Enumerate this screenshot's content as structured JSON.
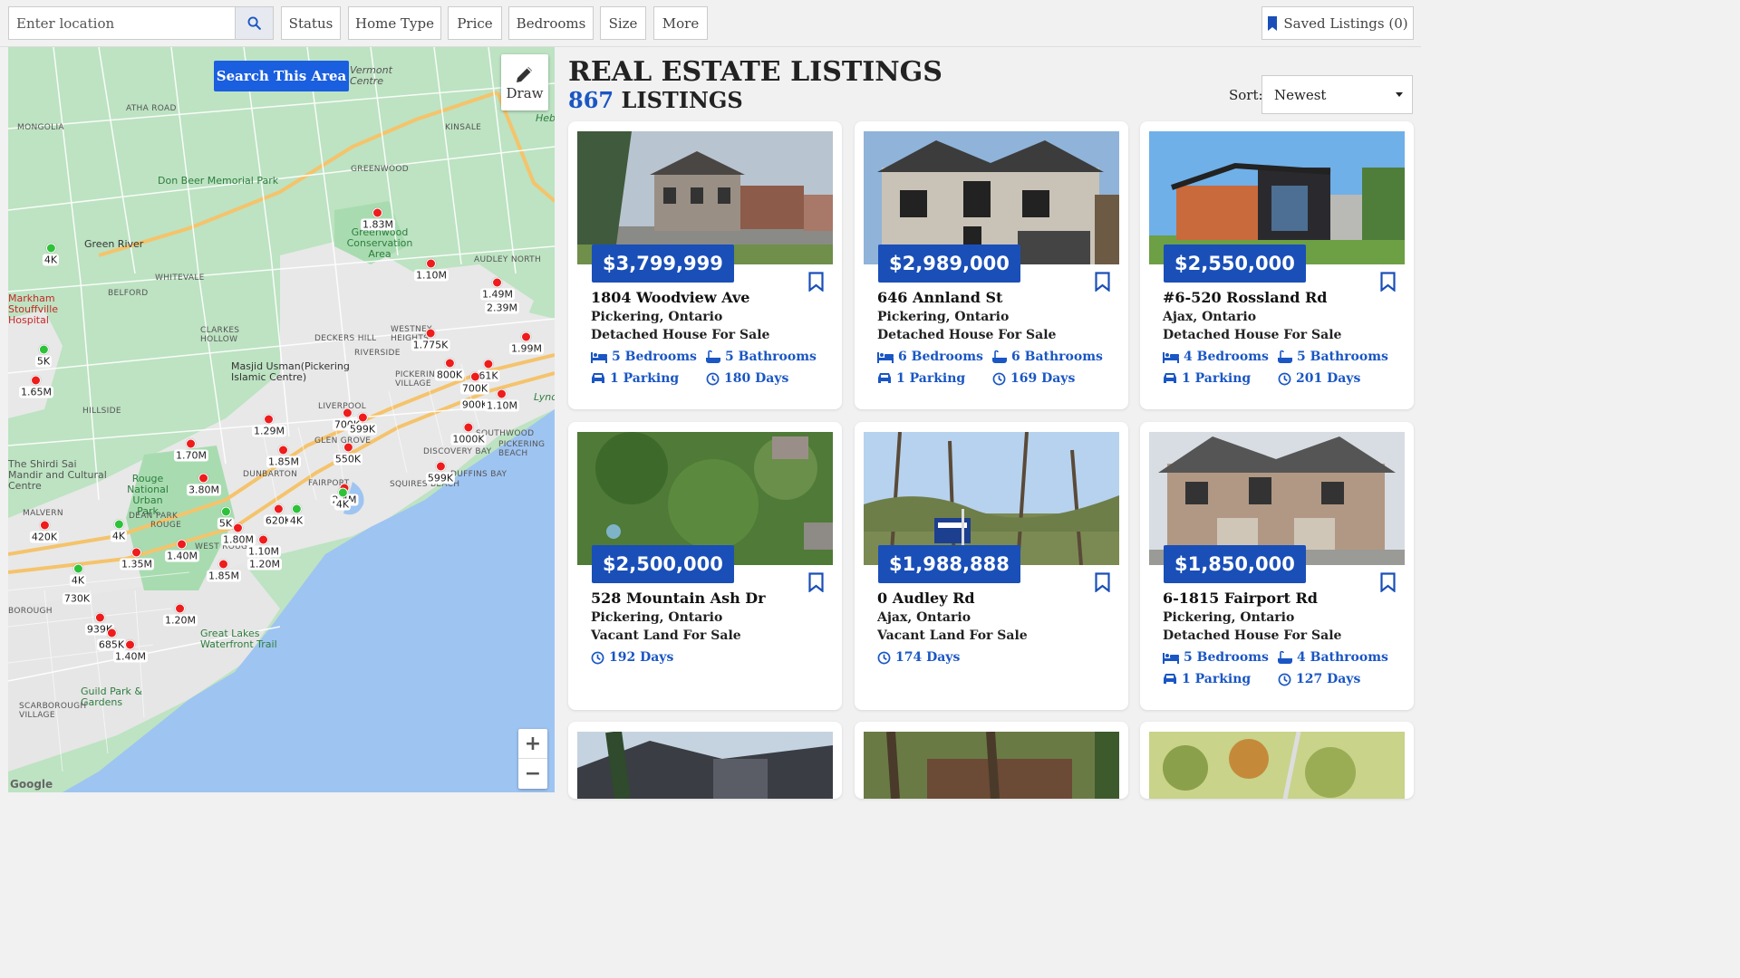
{
  "search": {
    "placeholder": "Enter location"
  },
  "filters": [
    "Status",
    "Home Type",
    "Price",
    "Bedrooms",
    "Size",
    "More"
  ],
  "saved_label": "Saved Listings (0)",
  "map": {
    "search_area_label": "Search This Area",
    "draw_label": "Draw",
    "zoom_in": "+",
    "zoom_out": "−",
    "attribution": "Google",
    "places": [
      "ATHA ROAD",
      "MONGOLIA",
      "Don Beer Memorial Park",
      "GREENWOOD",
      "KINSALE",
      "Green River",
      "WHITEVALE",
      "BELFORD",
      "Markham Stouffville Hospital",
      "CLARKES HOLLOW",
      "DECKERS HILL",
      "Masjid Usman(Pickering Islamic Centre)",
      "Greenwood Conservation Area",
      "AUDLEY NORTH",
      "WESTNEY HEIGHTS",
      "RIVERSIDE",
      "PICKERING VILLAGE",
      "HILLSIDE",
      "LIVERPOOL",
      "GLEN GROVE",
      "DUNBARTON",
      "FAIRPORT",
      "SQUIRES BEACH",
      "DISCOVERY BAY",
      "SOUTHWOOD",
      "PICKERING BEACH",
      "DUFFINS BAY",
      "Rouge National Urban Park",
      "The Shirdi Sai Mandir and Cultural Centre",
      "MALVERN",
      "DEAN PARK",
      "ROUGE",
      "WEST ROUGE",
      "Great Lakes Waterfront Trail",
      "Guild Park & Gardens",
      "SCARBOROUGH VILLAGE",
      "BOROUGH",
      "Lynde Conservation",
      "Vermont Centre",
      "Hebron Cons"
    ],
    "markers": [
      {
        "label": "4K",
        "color": "green"
      },
      {
        "label": "1.83M",
        "color": "red"
      },
      {
        "label": "1.10M",
        "color": "red"
      },
      {
        "label": "1.49M",
        "color": "red"
      },
      {
        "label": "2.39M",
        "color": "red"
      },
      {
        "label": "1.99M",
        "color": "red"
      },
      {
        "label": "5K",
        "color": "green"
      },
      {
        "label": "1.65M",
        "color": "red"
      },
      {
        "label": "1.775K",
        "color": "red"
      },
      {
        "label": "800K",
        "color": "red"
      },
      {
        "label": "61K",
        "color": "red"
      },
      {
        "label": "700K",
        "color": "red"
      },
      {
        "label": "900K",
        "color": "red"
      },
      {
        "label": "1.10M",
        "color": "red"
      },
      {
        "label": "1.29M",
        "color": "red"
      },
      {
        "label": "700K",
        "color": "red"
      },
      {
        "label": "599K",
        "color": "red"
      },
      {
        "label": "1000K",
        "color": "red"
      },
      {
        "label": "1.70M",
        "color": "red"
      },
      {
        "label": "1.85M",
        "color": "red"
      },
      {
        "label": "550K",
        "color": "red"
      },
      {
        "label": "599K",
        "color": "red"
      },
      {
        "label": "3.80M",
        "color": "red"
      },
      {
        "label": "2.4M",
        "color": "red"
      },
      {
        "label": "4K",
        "color": "green"
      },
      {
        "label": "5K",
        "color": "green"
      },
      {
        "label": "620K",
        "color": "red"
      },
      {
        "label": "4K",
        "color": "green"
      },
      {
        "label": "420K",
        "color": "red"
      },
      {
        "label": "4K",
        "color": "green"
      },
      {
        "label": "1.80M",
        "color": "red"
      },
      {
        "label": "1.10M",
        "color": "red"
      },
      {
        "label": "1.35M",
        "color": "red"
      },
      {
        "label": "1.40M",
        "color": "red"
      },
      {
        "label": "1.20M",
        "color": "red"
      },
      {
        "label": "1.85M",
        "color": "red"
      },
      {
        "label": "4K",
        "color": "green"
      },
      {
        "label": "730K",
        "color": "red"
      },
      {
        "label": "1.20M",
        "color": "red"
      },
      {
        "label": "939K",
        "color": "red"
      },
      {
        "label": "685K",
        "color": "red"
      },
      {
        "label": "1.40M",
        "color": "red"
      }
    ]
  },
  "header": {
    "title": "REAL ESTATE LISTINGS",
    "count": "867",
    "count_suffix": " LISTINGS",
    "sort_label": "Sort:",
    "sort_value": "Newest"
  },
  "listings": [
    {
      "price": "$3,799,999",
      "address": "1804 Woodview Ave",
      "city": "Pickering, Ontario",
      "type": "Detached House For Sale",
      "bedrooms": "5 Bedrooms",
      "bathrooms": "5 Bathrooms",
      "parking": "1 Parking",
      "days": "180 Days"
    },
    {
      "price": "$2,989,000",
      "address": "646 Annland St",
      "city": "Pickering, Ontario",
      "type": "Detached House For Sale",
      "bedrooms": "6 Bedrooms",
      "bathrooms": "6 Bathrooms",
      "parking": "1 Parking",
      "days": "169 Days"
    },
    {
      "price": "$2,550,000",
      "address": "#6-520 Rossland Rd",
      "city": "Ajax, Ontario",
      "type": "Detached House For Sale",
      "bedrooms": "4 Bedrooms",
      "bathrooms": "5 Bathrooms",
      "parking": "1 Parking",
      "days": "201 Days"
    },
    {
      "price": "$2,500,000",
      "address": "528 Mountain Ash Dr",
      "city": "Pickering, Ontario",
      "type": "Vacant Land For Sale",
      "days": "192 Days"
    },
    {
      "price": "$1,988,888",
      "address": "0 Audley Rd",
      "city": "Ajax, Ontario",
      "type": "Vacant Land For Sale",
      "days": "174 Days"
    },
    {
      "price": "$1,850,000",
      "address": "6-1815 Fairport Rd",
      "city": "Pickering, Ontario",
      "type": "Detached House For Sale",
      "bedrooms": "5 Bedrooms",
      "bathrooms": "4 Bathrooms",
      "parking": "1 Parking",
      "days": "127 Days"
    }
  ]
}
